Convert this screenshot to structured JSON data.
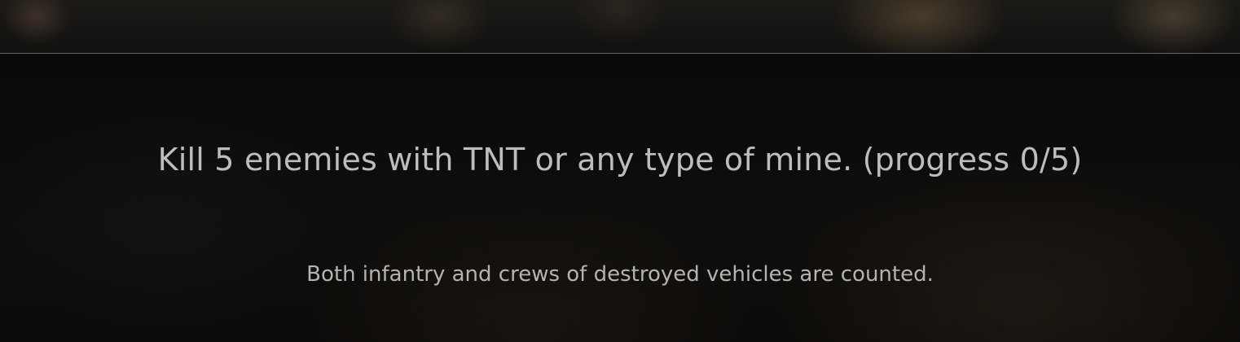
{
  "task": {
    "title": "Kill 5 enemies with TNT or any type of mine. (progress 0/5)",
    "note": "Both infantry and crews of destroyed vehicles are counted.",
    "progress": {
      "current": 0,
      "target": 5
    }
  },
  "colors": {
    "background": "#0c0b0a",
    "text_primary": "#bdbdbb",
    "text_secondary": "#b4b3b1",
    "divider": "#6b6864"
  }
}
